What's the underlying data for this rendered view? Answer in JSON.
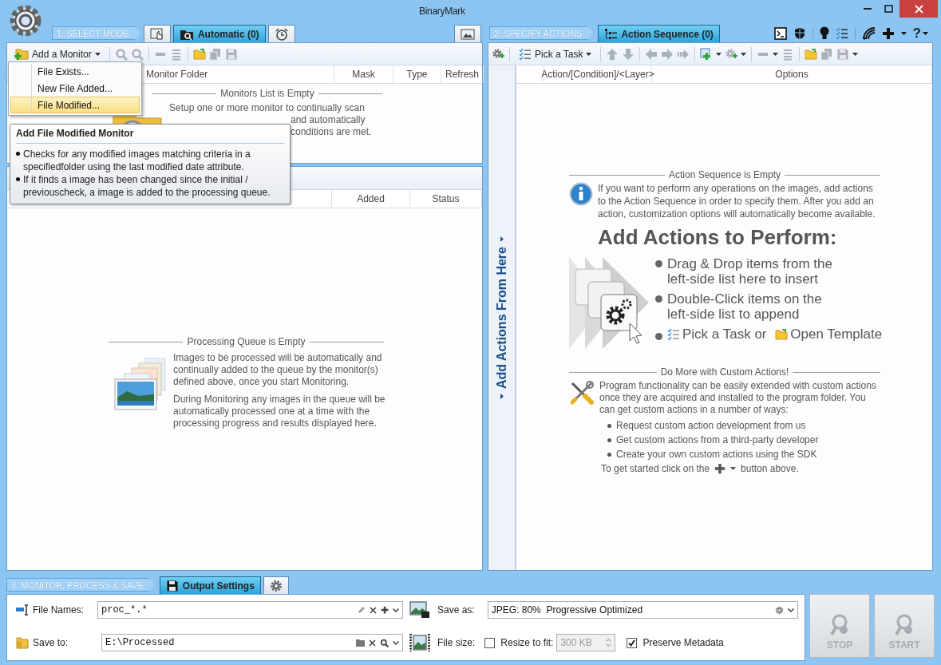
{
  "window": {
    "title": "BinaryMark"
  },
  "mode": {
    "step": "1. SELECT MODE",
    "tabs": [
      {
        "kind": "manual",
        "selected": false
      },
      {
        "kind": "automatic",
        "label": "Automatic (0)",
        "selected": true
      },
      {
        "kind": "scheduled",
        "selected": false
      }
    ]
  },
  "monitors": {
    "add_button": "Add a Monitor",
    "menu": [
      {
        "label": "File Exists...",
        "selected": false
      },
      {
        "label": "New File Added...",
        "selected": false
      },
      {
        "label": "File Modified...",
        "selected": true
      }
    ],
    "columns": [
      "Monitor Folder",
      "Mask",
      "Type",
      "Refresh"
    ],
    "empty_title": "Monitors List is Empty",
    "empty_lines": [
      "Setup one or more monitor to continually scan",
      "and automatically",
      "conditions are met."
    ]
  },
  "tooltip": {
    "title": "Add File Modified Monitor",
    "bullets": [
      "Checks for any modified images matching criteria in a specifiedfolder using the last modified date attribute.",
      "If it finds a image has been changed since the initial / previouscheck, a image is added to the processing queue."
    ]
  },
  "queue": {
    "columns": [
      "Added",
      "Status"
    ],
    "empty_title": "Processing Queue is Empty",
    "paragraphs": [
      "Images to be processed will be automatically and continually added to the queue by the monitor(s) defined above, once you start Monitoring.",
      "During Monitoring any images in the queue will be automatically processed one at a time with the processing progress and results displayed here."
    ]
  },
  "actions": {
    "step": "2. SPECIFY ACTIONS",
    "tabs": [
      {
        "label": "Action Sequence (0)",
        "selected": true
      }
    ],
    "help_button": "?",
    "pick_task": "Pick a Task",
    "columns": [
      "Action/[Condition]/<Layer>",
      "Options"
    ],
    "side_label": "Add Actions From Here",
    "empty_title": "Action Sequence is Empty",
    "info": "If you want to perform any operations on the images, add actions to the Action Sequence in order to specify them. After you add an action, customization options will automatically become available.",
    "heading": "Add Actions to Perform:",
    "steps": [
      "Drag & Drop items from the left-side list here to insert",
      "Double-Click items on the left-side list to append"
    ],
    "last_step": [
      "Pick a Task or",
      "Open Template"
    ],
    "custom_title": "Do More with Custom Actions!",
    "custom_text": "Program functionality can be easily extended with custom actions once they are acquired and installed to the program folder. You can get custom actions in a number of ways:",
    "custom_bullets": [
      "Request custom action development from us",
      "Get custom actions from a third-party developer",
      "Create your own custom actions using the SDK"
    ],
    "footer": [
      "To get started click on the",
      "button above."
    ]
  },
  "output": {
    "step": "3. MONITOR, PROCESS & SAVE",
    "tabs": [
      {
        "kind": "output",
        "label": "Output Settings",
        "selected": true
      },
      {
        "kind": "settings",
        "selected": false
      }
    ],
    "file_names": {
      "label": "File Names:",
      "value": "proc_*.*"
    },
    "save_to": {
      "label": "Save to:",
      "value": "E:\\Processed"
    },
    "save_as": {
      "label": "Save as:",
      "value": "JPEG: 80%  Progressive Optimized"
    },
    "file_size": {
      "label": "File size:",
      "resize": {
        "label": "Resize to fit:",
        "checked": false
      },
      "size": {
        "value": "300 KB",
        "disabled": true
      },
      "preserve": {
        "label": "Preserve Metadata",
        "checked": true
      }
    },
    "buttons": [
      {
        "label": "STOP",
        "disabled": true
      },
      {
        "label": "START",
        "disabled": true
      }
    ]
  }
}
